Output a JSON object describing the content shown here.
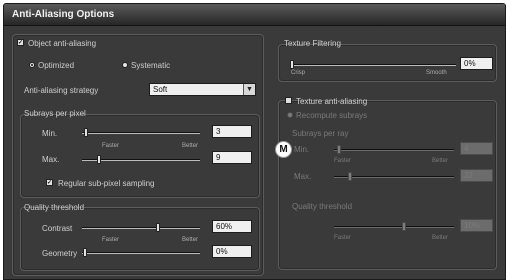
{
  "window": {
    "title": "Anti-Aliasing Options"
  },
  "object_aa": {
    "group_label": "Object anti-aliasing",
    "radio_optimized": "Optimized",
    "radio_systematic": "Systematic",
    "strategy_label": "Anti-aliasing strategy",
    "strategy_value": "Soft",
    "subrays": {
      "title": "Subrays per pixel",
      "min_label": "Min.",
      "max_label": "Max.",
      "faster": "Faster",
      "better": "Better",
      "min_value": "3",
      "max_value": "9"
    },
    "regular_sampling_label": "Regular sub-pixel sampling",
    "quality": {
      "title": "Quality threshold",
      "contrast_label": "Contrast",
      "geometry_label": "Geometry",
      "faster": "Faster",
      "better": "Better",
      "contrast_value": "60%",
      "geometry_value": "0%"
    }
  },
  "texture_filtering": {
    "title": "Texture Filtering",
    "crisp": "Crisp",
    "smooth": "Smooth",
    "value": "0%"
  },
  "texture_aa": {
    "label": "Texture anti-aliasing",
    "recompute": "Recompute subrays",
    "subrays_title": "Subrays per ray",
    "min_label": "Min.",
    "max_label": "Max.",
    "faster": "Faster",
    "better": "Better",
    "min_value": "4",
    "max_value": "32",
    "quality_title": "Quality threshold",
    "quality_value": "10%"
  },
  "badge": {
    "text": "M"
  },
  "colors": {
    "window_bg": "#3a3a3a",
    "field_bg": "#efefef",
    "disabled_text": "#7a7a7a"
  }
}
